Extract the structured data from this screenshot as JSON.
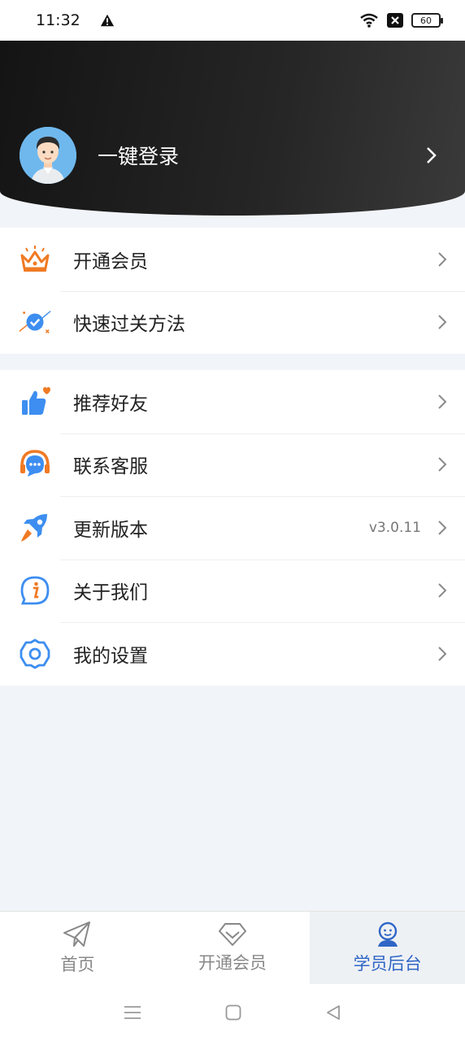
{
  "status_bar": {
    "time": "11:32",
    "battery": "60",
    "icons": [
      "warning-icon",
      "wifi-icon",
      "notification-x-icon",
      "battery-icon"
    ]
  },
  "profile": {
    "login_label": "一键登录",
    "avatar": "avatar-icon"
  },
  "menu_group_1": [
    {
      "label": "开通会员",
      "icon": "crown-icon"
    },
    {
      "label": "快速过关方法",
      "icon": "check-badge-icon"
    }
  ],
  "menu_group_2": [
    {
      "label": "推荐好友",
      "icon": "thumbs-up-icon"
    },
    {
      "label": "联系客服",
      "icon": "headset-icon"
    },
    {
      "label": "更新版本",
      "icon": "rocket-icon",
      "value": "v3.0.11"
    },
    {
      "label": "关于我们",
      "icon": "info-icon"
    },
    {
      "label": "我的设置",
      "icon": "settings-icon"
    }
  ],
  "bottom_nav": [
    {
      "label": "首页",
      "icon": "paper-plane-icon",
      "active": false
    },
    {
      "label": "开通会员",
      "icon": "diamond-icon",
      "active": false
    },
    {
      "label": "学员后台",
      "icon": "user-icon",
      "active": true
    }
  ],
  "colors": {
    "accent": "#2f66c6",
    "orange": "#f07a23",
    "blue_icon": "#3d8ef0",
    "header_dark": "#1a1a1a"
  }
}
